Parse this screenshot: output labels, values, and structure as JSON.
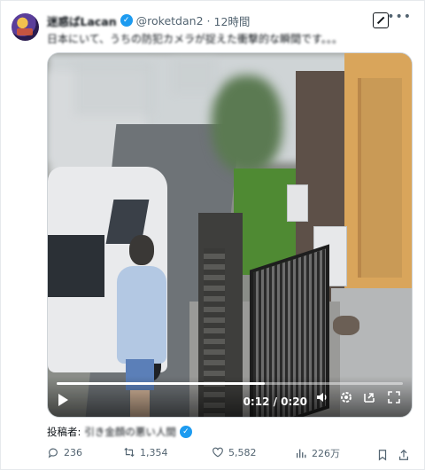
{
  "author": {
    "display_name": "迷惑ばLacan",
    "handle": "@roketdan2",
    "separator": "·",
    "time": "12時間"
  },
  "tweet": {
    "text": "日本にいて、うちの防犯カメラが捉えた衝撃的な瞬間です。。。"
  },
  "video": {
    "time_readout": "0:12 / 0:20",
    "progress": 0.6
  },
  "credit": {
    "label": "投稿者:",
    "name": "引き金顔の悪い人間"
  },
  "actions": {
    "replies": "236",
    "retweets": "1,354",
    "likes": "5,582",
    "views": "226万"
  },
  "colors": {
    "verified": "#1d9bf0",
    "muted_text": "#536471"
  }
}
